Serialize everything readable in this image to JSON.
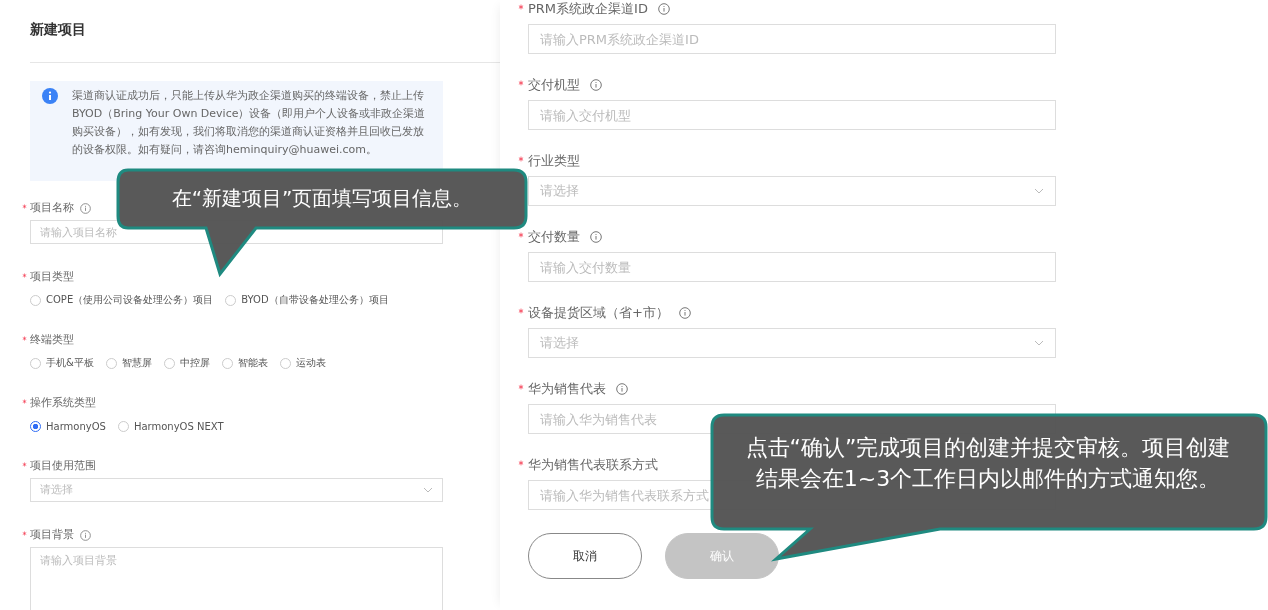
{
  "left_panel": {
    "title": "新建项目",
    "notice": {
      "text": "渠道商认证成功后，只能上传从华为政企渠道购买的终端设备，禁止上传BYOD（Bring Your Own Device）设备（即用户个人设备或非政企渠道购买设备），如有发现，我们将取消您的渠道商认证资格并且回收已发放的设备权限。如有疑问，请咨询heminquiry@huawei.com。"
    },
    "fields": [
      {
        "kind": "text",
        "label": "项目名称",
        "required": true,
        "info": true,
        "placeholder": "请输入项目名称"
      },
      {
        "kind": "radio",
        "label": "项目类型",
        "required": true,
        "options": [
          {
            "label": "COPE（使用公司设备处理公务）项目",
            "selected": false
          },
          {
            "label": "BYOD（自带设备处理公务）项目",
            "selected": false
          }
        ]
      },
      {
        "kind": "radio",
        "label": "终端类型",
        "required": true,
        "options": [
          {
            "label": "手机&平板",
            "selected": false
          },
          {
            "label": "智慧屏",
            "selected": false
          },
          {
            "label": "中控屏",
            "selected": false
          },
          {
            "label": "智能表",
            "selected": false
          },
          {
            "label": "运动表",
            "selected": false
          }
        ]
      },
      {
        "kind": "radio",
        "label": "操作系统类型",
        "required": true,
        "options": [
          {
            "label": "HarmonyOS",
            "selected": true
          },
          {
            "label": "HarmonyOS NEXT",
            "selected": false
          }
        ]
      },
      {
        "kind": "select",
        "label": "项目使用范围",
        "required": true,
        "placeholder": "请选择"
      },
      {
        "kind": "textarea",
        "label": "项目背景",
        "required": true,
        "info": true,
        "placeholder": "请输入项目背景"
      }
    ]
  },
  "right_panel": {
    "fields": [
      {
        "kind": "text",
        "label": "PRM系统政企渠道ID",
        "required": true,
        "info": true,
        "placeholder": "请输入PRM系统政企渠道ID"
      },
      {
        "kind": "text",
        "label": "交付机型",
        "required": true,
        "info": true,
        "placeholder": "请输入交付机型"
      },
      {
        "kind": "select",
        "label": "行业类型",
        "required": true,
        "placeholder": "请选择"
      },
      {
        "kind": "text",
        "label": "交付数量",
        "required": true,
        "info": true,
        "placeholder": "请输入交付数量"
      },
      {
        "kind": "select",
        "label": "设备提货区域（省+市）",
        "required": true,
        "info": true,
        "placeholder": "请选择"
      },
      {
        "kind": "text",
        "label": "华为销售代表",
        "required": true,
        "info": true,
        "placeholder": "请输入华为销售代表"
      },
      {
        "kind": "text",
        "label": "华为销售代表联系方式",
        "required": true,
        "placeholder": "请输入华为销售代表联系方式"
      }
    ],
    "buttons": [
      {
        "label": "取消",
        "disabled": false
      },
      {
        "label": "确认",
        "disabled": true
      }
    ]
  },
  "callouts": [
    {
      "text": "在“新建项目”页面填写项目信息。"
    },
    {
      "text": "点击“确认”完成项目的创建并提交审核。项目创建结果会在1~3个工作日内以邮件的方式通知您。"
    }
  ]
}
